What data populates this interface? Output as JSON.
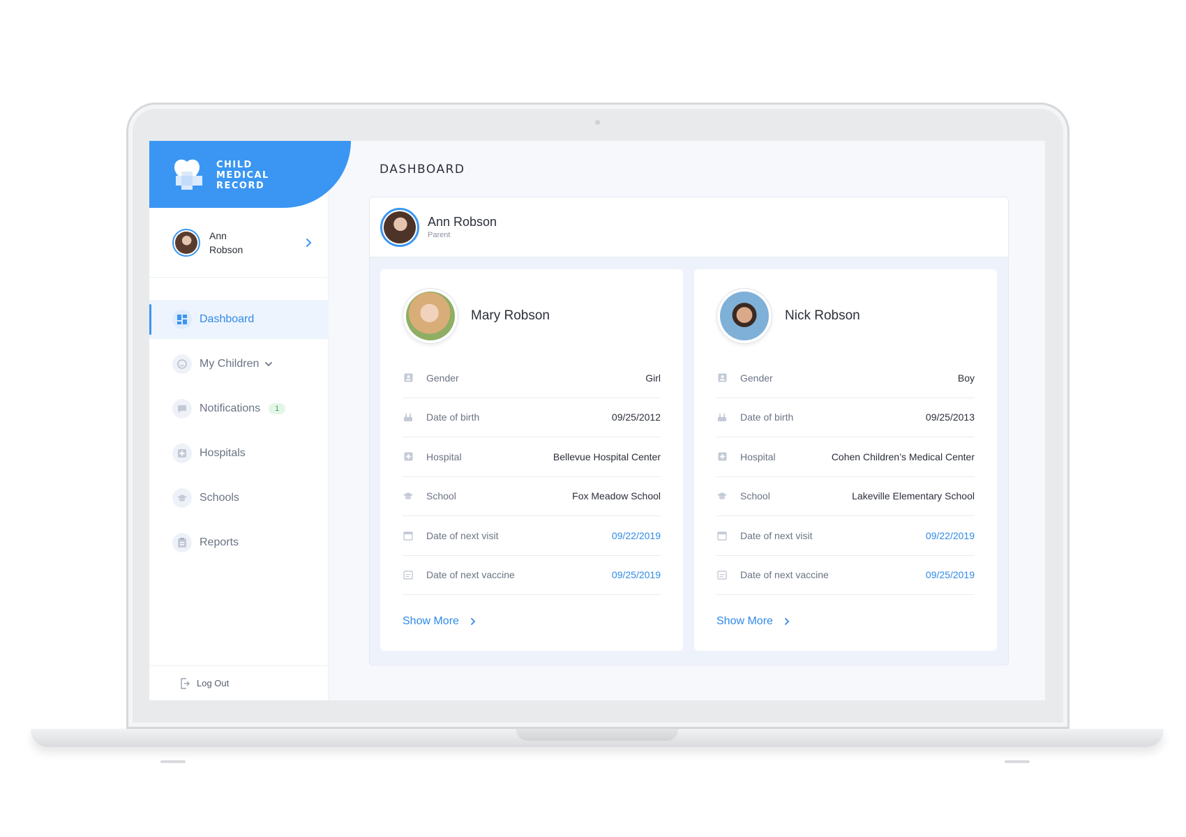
{
  "brand": {
    "line1": "CHILD",
    "line2": "MEDICAL",
    "line3": "RECORD",
    "color": "#3a96f2"
  },
  "sidebar": {
    "user": {
      "first": "Ann",
      "last": "Robson"
    },
    "items": [
      {
        "label": "Dashboard",
        "icon": "dashboard-icon",
        "active": true
      },
      {
        "label": "My Children",
        "icon": "child-face-icon"
      },
      {
        "label": "Notifications",
        "icon": "chat-icon",
        "badge": "1"
      },
      {
        "label": "Hospitals",
        "icon": "hospital-cross-icon"
      },
      {
        "label": "Schools",
        "icon": "graduation-cap-icon"
      },
      {
        "label": "Reports",
        "icon": "report-icon"
      }
    ],
    "logout": "Log Out"
  },
  "main": {
    "title": "DASHBOARD",
    "parent": {
      "name": "Ann Robson",
      "role": "Parent"
    },
    "children": [
      {
        "name": "Mary Robson",
        "rows": [
          {
            "label": "Gender",
            "value": "Girl"
          },
          {
            "label": "Date of birth",
            "value": "09/25/2012"
          },
          {
            "label": "Hospital",
            "value": "Bellevue Hospital Center"
          },
          {
            "label": "School",
            "value": "Fox Meadow School"
          },
          {
            "label": "Date of next visit",
            "value": "09/22/2019"
          },
          {
            "label": "Date of next vaccine",
            "value": "09/25/2019"
          }
        ],
        "show_more": "Show More"
      },
      {
        "name": "Nick Robson",
        "rows": [
          {
            "label": "Gender",
            "value": "Boy"
          },
          {
            "label": "Date of birth",
            "value": "09/25/2013"
          },
          {
            "label": "Hospital",
            "value": "Cohen Children’s Medical Center"
          },
          {
            "label": "School",
            "value": "Lakeville Elementary School"
          },
          {
            "label": "Date of next visit",
            "value": "09/22/2019"
          },
          {
            "label": "Date of next vaccine",
            "value": "09/25/2019"
          }
        ],
        "show_more": "Show More"
      }
    ]
  },
  "colors": {
    "accent": "#3a96f2",
    "link": "#2f8ae6",
    "badge_bg": "#e5f6e8",
    "badge_text": "#3aa85a"
  }
}
